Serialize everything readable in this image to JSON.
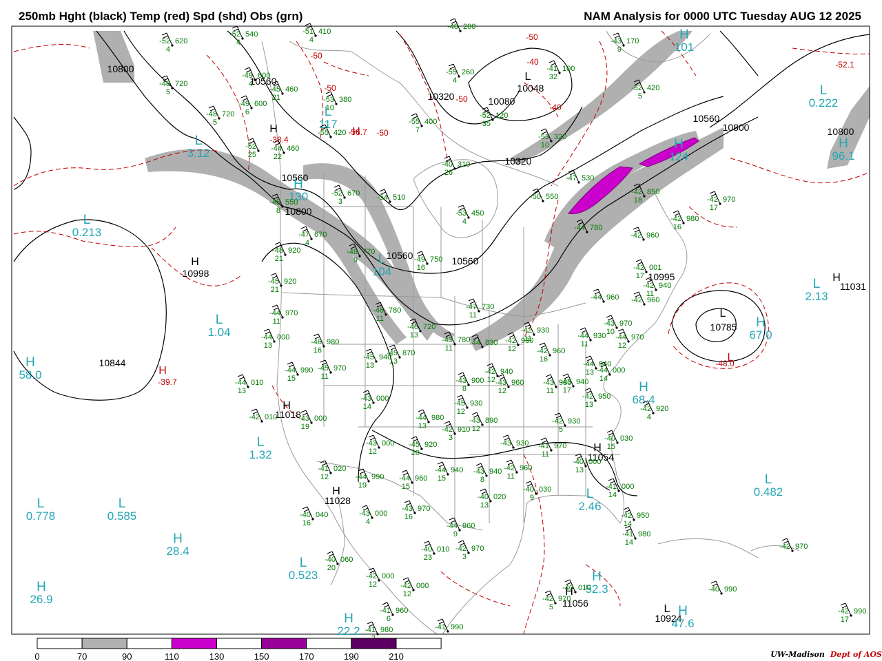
{
  "header": {
    "title_left": "250mb Hght (black) Temp (red) Spd (shd) Obs (grn)",
    "title_right": "NAM Analysis for 0000 UTC Tuesday  AUG 12 2025"
  },
  "credit": {
    "org": "UW-Madison",
    "dept": "Dept of AOS"
  },
  "colors": {
    "height": "#000000",
    "temp": "#c00000",
    "obs": "#007a00",
    "speed_label": "#22a6b4",
    "shade_70": "#b0b0b0",
    "shade_110": "#cc00cc",
    "shade_150": "#990099",
    "shade_190": "#5a0060",
    "geography": "#9a9a9a"
  },
  "colorbar": {
    "ticks": [
      "0",
      "70",
      "90",
      "110",
      "130",
      "150",
      "170",
      "190",
      "210"
    ],
    "segments": [
      {
        "color": "#ffffff"
      },
      {
        "color": "#b0b0b0"
      },
      {
        "color": "#ffffff"
      },
      {
        "color": "#cc00cc"
      },
      {
        "color": "#ffffff"
      },
      {
        "color": "#990099"
      },
      {
        "color": "#ffffff"
      },
      {
        "color": "#5a0060"
      },
      {
        "color": "#ffffff"
      }
    ]
  },
  "height_labels": [
    {
      "text": "10800"
    },
    {
      "text": "10560"
    },
    {
      "text": "10320"
    },
    {
      "text": "10080"
    },
    {
      "text": "10048"
    },
    {
      "text": "10320"
    },
    {
      "text": "10560"
    },
    {
      "text": "10800"
    },
    {
      "text": "10800"
    },
    {
      "text": "10560"
    },
    {
      "text": "10800"
    },
    {
      "text": "10560"
    },
    {
      "text": "10560"
    },
    {
      "text": "10998"
    },
    {
      "text": "10844"
    },
    {
      "text": "11018"
    },
    {
      "text": "11028"
    },
    {
      "text": "10995"
    },
    {
      "text": "10785"
    },
    {
      "text": "11031"
    },
    {
      "text": "11054"
    },
    {
      "text": "11056"
    },
    {
      "text": "10924"
    }
  ],
  "hl_markers": [
    {
      "letter": "L",
      "color": "black"
    },
    {
      "letter": "H",
      "color": "black"
    },
    {
      "letter": "H",
      "color": "black"
    },
    {
      "letter": "H",
      "color": "black"
    },
    {
      "letter": "H",
      "color": "black"
    },
    {
      "letter": "L",
      "color": "black"
    },
    {
      "letter": "H",
      "color": "black"
    },
    {
      "letter": "H",
      "color": "black"
    },
    {
      "letter": "H",
      "color": "black"
    },
    {
      "letter": "L",
      "color": "black"
    },
    {
      "letter": "H",
      "color": "red"
    },
    {
      "letter": "H",
      "color": "red"
    },
    {
      "letter": "L",
      "color": "red"
    }
  ],
  "speed_labels": [
    {
      "letter": "L",
      "value": "3.12"
    },
    {
      "letter": "L",
      "value": "0.213"
    },
    {
      "letter": "L",
      "value": "117"
    },
    {
      "letter": "H",
      "value": "130"
    },
    {
      "letter": "L",
      "value": "104"
    },
    {
      "letter": "L",
      "value": "1.04"
    },
    {
      "letter": "H",
      "value": "58.0"
    },
    {
      "letter": "L",
      "value": "1.32"
    },
    {
      "letter": "L",
      "value": "0.778"
    },
    {
      "letter": "L",
      "value": "0.585"
    },
    {
      "letter": "H",
      "value": "28.4"
    },
    {
      "letter": "H",
      "value": "26.9"
    },
    {
      "letter": "L",
      "value": "0.523"
    },
    {
      "letter": "H",
      "value": "22.2"
    },
    {
      "letter": "H",
      "value": "52.3"
    },
    {
      "letter": "H",
      "value": "47.6"
    },
    {
      "letter": "L",
      "value": "2.46"
    },
    {
      "letter": "L",
      "value": "0.482"
    },
    {
      "letter": "H",
      "value": "68.4"
    },
    {
      "letter": "H",
      "value": "67.0"
    },
    {
      "letter": "L",
      "value": "2.13"
    },
    {
      "letter": "L",
      "value": "0.222"
    },
    {
      "letter": "H",
      "value": "101"
    },
    {
      "letter": "H",
      "value": "124"
    },
    {
      "letter": "H",
      "value": "96.1"
    }
  ],
  "temp_labels": [
    {
      "text": "-50"
    },
    {
      "text": "-50"
    },
    {
      "text": "-50"
    },
    {
      "text": "-40"
    },
    {
      "text": "-50"
    },
    {
      "text": "-50"
    },
    {
      "text": "-40"
    },
    {
      "text": "-52.1"
    },
    {
      "text": "-56.7"
    },
    {
      "text": "-38.4"
    },
    {
      "text": "-39.7"
    },
    {
      "text": "-48.0"
    }
  ],
  "obs_stations": [
    {
      "temp": "-52",
      "hgt": "540",
      "spd": "4"
    },
    {
      "temp": "-51",
      "hgt": "410",
      "spd": "4"
    },
    {
      "temp": "-52",
      "hgt": "620",
      "spd": "4"
    },
    {
      "temp": "-48",
      "hgt": "200",
      "spd": ""
    },
    {
      "temp": "-43",
      "hgt": "170",
      "spd": "9"
    },
    {
      "temp": "-49",
      "hgt": "600",
      "spd": "4"
    },
    {
      "temp": "-48",
      "hgt": "720",
      "spd": "5"
    },
    {
      "temp": "-45",
      "hgt": "460",
      "spd": "21"
    },
    {
      "temp": "-53",
      "hgt": "380",
      "spd": "10"
    },
    {
      "temp": "-55",
      "hgt": "260",
      "spd": "4"
    },
    {
      "temp": "-41",
      "hgt": "100",
      "spd": "32"
    },
    {
      "temp": "-49",
      "hgt": "600",
      "spd": "6"
    },
    {
      "temp": "-48",
      "hgt": "720",
      "spd": "5"
    },
    {
      "temp": "-55",
      "hgt": "400",
      "spd": "7"
    },
    {
      "temp": "-52",
      "hgt": "120",
      "spd": "35"
    },
    {
      "temp": "-52",
      "hgt": "420",
      "spd": "5"
    },
    {
      "temp": "-53",
      "hgt": "320",
      "spd": "10"
    },
    {
      "temp": "-55",
      "hgt": "420",
      "spd": ""
    },
    {
      "temp": "-44",
      "hgt": "460",
      "spd": "22"
    },
    {
      "temp": "-52",
      "hgt": "",
      "spd": "25"
    },
    {
      "temp": "-40",
      "hgt": "310",
      "spd": "26"
    },
    {
      "temp": "-47",
      "hgt": "530",
      "spd": ""
    },
    {
      "temp": "-42",
      "hgt": "850",
      "spd": "18"
    },
    {
      "temp": "-42",
      "hgt": "970",
      "spd": "17"
    },
    {
      "temp": "-52",
      "hgt": "670",
      "spd": "3"
    },
    {
      "temp": "-54",
      "hgt": "510",
      "spd": ""
    },
    {
      "temp": "-50",
      "hgt": "550",
      "spd": ""
    },
    {
      "temp": "-45",
      "hgt": "550",
      "spd": "8"
    },
    {
      "temp": "-53",
      "hgt": "450",
      "spd": "4"
    },
    {
      "temp": "-42",
      "hgt": "980",
      "spd": "16"
    },
    {
      "temp": "-47",
      "hgt": "670",
      "spd": "4"
    },
    {
      "temp": "-44",
      "hgt": "780",
      "spd": ""
    },
    {
      "temp": "-42",
      "hgt": "960",
      "spd": ""
    },
    {
      "temp": "-48",
      "hgt": "920",
      "spd": "21"
    },
    {
      "temp": "-48",
      "hgt": "770",
      "spd": "9"
    },
    {
      "temp": "-49",
      "hgt": "750",
      "spd": "16"
    },
    {
      "temp": "-42",
      "hgt": "001",
      "spd": "17"
    },
    {
      "temp": "-42",
      "hgt": "940",
      "spd": "11"
    },
    {
      "temp": "-45",
      "hgt": "920",
      "spd": "21"
    },
    {
      "temp": "-46",
      "hgt": "780",
      "spd": "11"
    },
    {
      "temp": "-47",
      "hgt": "730",
      "spd": "11"
    },
    {
      "temp": "-44",
      "hgt": "960",
      "spd": ""
    },
    {
      "temp": "-42",
      "hgt": "960",
      "spd": ""
    },
    {
      "temp": "-44",
      "hgt": "970",
      "spd": "11"
    },
    {
      "temp": "-46",
      "hgt": "720",
      "spd": "13"
    },
    {
      "temp": "-43",
      "hgt": "780",
      "spd": "11"
    },
    {
      "temp": "-44",
      "hgt": "830",
      "spd": ""
    },
    {
      "temp": "-42",
      "hgt": "930",
      "spd": "12"
    },
    {
      "temp": "-43",
      "hgt": "970",
      "spd": "10"
    },
    {
      "temp": "-44",
      "hgt": "000",
      "spd": "13"
    },
    {
      "temp": "-46",
      "hgt": "980",
      "spd": "16"
    },
    {
      "temp": "-45",
      "hgt": "870",
      "spd": "13"
    },
    {
      "temp": "-42",
      "hgt": "960",
      "spd": "16"
    },
    {
      "temp": "-42",
      "hgt": "930",
      "spd": "11"
    },
    {
      "temp": "-44",
      "hgt": "930",
      "spd": "11"
    },
    {
      "temp": "-44",
      "hgt": "970",
      "spd": "12"
    },
    {
      "temp": "-45",
      "hgt": "940",
      "spd": "13"
    },
    {
      "temp": "-43",
      "hgt": "960",
      "spd": "12"
    },
    {
      "temp": "-43",
      "hgt": "940",
      "spd": "17"
    },
    {
      "temp": "-44",
      "hgt": "940",
      "spd": "13"
    },
    {
      "temp": "-44",
      "hgt": "000",
      "spd": "14"
    },
    {
      "temp": "-44",
      "hgt": "990",
      "spd": "15"
    },
    {
      "temp": "-45",
      "hgt": "970",
      "spd": "11"
    },
    {
      "temp": "-44",
      "hgt": "010",
      "spd": "13"
    },
    {
      "temp": "-42",
      "hgt": "940",
      "spd": "12"
    },
    {
      "temp": "-43",
      "hgt": "900",
      "spd": "8"
    },
    {
      "temp": "-43",
      "hgt": "980",
      "spd": "11"
    },
    {
      "temp": "-42",
      "hgt": "950",
      "spd": "13"
    },
    {
      "temp": "-43",
      "hgt": "000",
      "spd": "14"
    },
    {
      "temp": "-45",
      "hgt": "930",
      "spd": "12"
    },
    {
      "temp": "-42",
      "hgt": "920",
      "spd": "4"
    },
    {
      "temp": "-42",
      "hgt": "010",
      "spd": ""
    },
    {
      "temp": "-43",
      "hgt": "000",
      "spd": "19"
    },
    {
      "temp": "-44",
      "hgt": "980",
      "spd": "13"
    },
    {
      "temp": "-43",
      "hgt": "890",
      "spd": "12"
    },
    {
      "temp": "-42",
      "hgt": "930",
      "spd": "5"
    },
    {
      "temp": "-43",
      "hgt": "000",
      "spd": "12"
    },
    {
      "temp": "-45",
      "hgt": "920",
      "spd": "20"
    },
    {
      "temp": "-42",
      "hgt": "910",
      "spd": "3"
    },
    {
      "temp": "-43",
      "hgt": "930",
      "spd": ""
    },
    {
      "temp": "-41",
      "hgt": "970",
      "spd": "11"
    },
    {
      "temp": "-40",
      "hgt": "030",
      "spd": "15"
    },
    {
      "temp": "-41",
      "hgt": "020",
      "spd": "12"
    },
    {
      "temp": "-44",
      "hgt": "990",
      "spd": "19"
    },
    {
      "temp": "-44",
      "hgt": "960",
      "spd": "15"
    },
    {
      "temp": "-44",
      "hgt": "940",
      "spd": "15"
    },
    {
      "temp": "-43",
      "hgt": "940",
      "spd": "8"
    },
    {
      "temp": "-42",
      "hgt": "960",
      "spd": "11"
    },
    {
      "temp": "-40",
      "hgt": "000",
      "spd": "13"
    },
    {
      "temp": "-40",
      "hgt": "030",
      "spd": "9"
    },
    {
      "temp": "-40",
      "hgt": "020",
      "spd": "13"
    },
    {
      "temp": "-41",
      "hgt": "000",
      "spd": "14"
    },
    {
      "temp": "-40",
      "hgt": "040",
      "spd": "16"
    },
    {
      "temp": "-43",
      "hgt": "000",
      "spd": "4"
    },
    {
      "temp": "-43",
      "hgt": "970",
      "spd": "16"
    },
    {
      "temp": "-44",
      "hgt": "960",
      "spd": "9"
    },
    {
      "temp": "-42",
      "hgt": "950",
      "spd": "14"
    },
    {
      "temp": "-40",
      "hgt": "010",
      "spd": "23"
    },
    {
      "temp": "-42",
      "hgt": "970",
      "spd": "3"
    },
    {
      "temp": "-41",
      "hgt": "980",
      "spd": "14"
    },
    {
      "temp": "-40",
      "hgt": "060",
      "spd": "20"
    },
    {
      "temp": "-42",
      "hgt": "000",
      "spd": "12"
    },
    {
      "temp": "-42",
      "hgt": "000",
      "spd": "12"
    },
    {
      "temp": "-41",
      "hgt": "960",
      "spd": "6"
    },
    {
      "temp": "-41",
      "hgt": "980",
      "spd": "2"
    },
    {
      "temp": "-41",
      "hgt": "990",
      "spd": ""
    },
    {
      "temp": "-40",
      "hgt": "010",
      "spd": ""
    },
    {
      "temp": "-40",
      "hgt": "990",
      "spd": ""
    },
    {
      "temp": "-42",
      "hgt": "970",
      "spd": ""
    },
    {
      "temp": "-42",
      "hgt": "990",
      "spd": "17"
    },
    {
      "temp": "-42",
      "hgt": "970",
      "spd": "5"
    },
    {
      "temp": "-40",
      "hgt": "",
      "spd": "21"
    }
  ]
}
